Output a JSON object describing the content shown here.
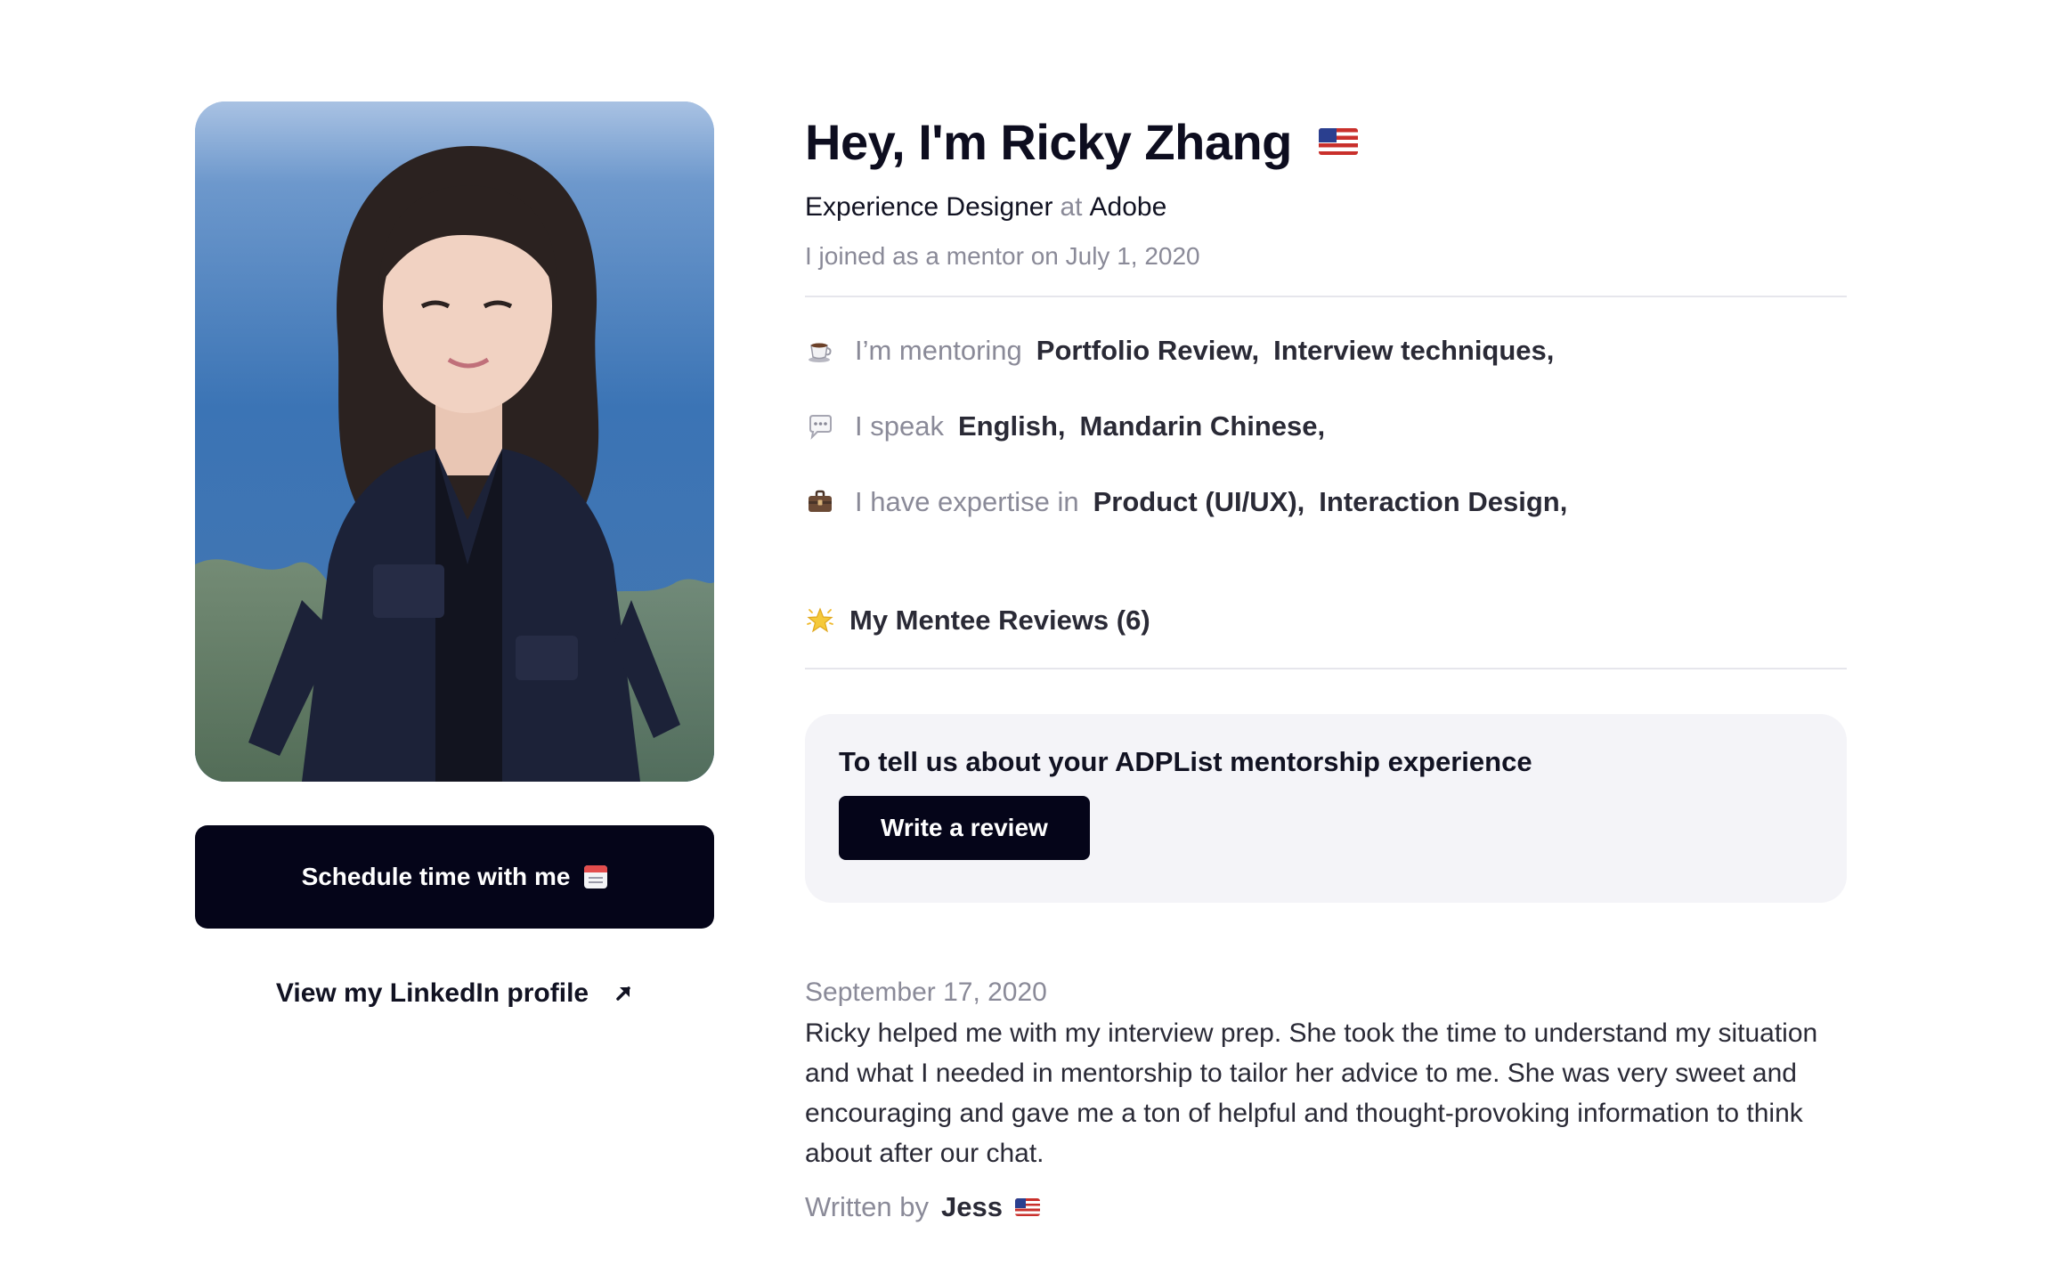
{
  "profile": {
    "name_heading": "Hey, I'm Ricky Zhang",
    "country_flag_icon": "us-flag-icon",
    "title": "Experience Designer",
    "at_text": "at",
    "company": "Adobe",
    "joined_prefix": "I joined as a mentor on",
    "joined_date": "July 1, 2020",
    "photo_alt": "Profile photo of Ricky Zhang"
  },
  "actions": {
    "schedule_label": "Schedule time with me",
    "schedule_icon": "calendar-icon",
    "linkedin_label": "View my LinkedIn profile",
    "linkedin_icon": "arrow-up-right-icon"
  },
  "info": {
    "mentoring": {
      "icon": "coffee-icon",
      "label": "I’m mentoring",
      "values": [
        "Portfolio Review,",
        "Interview techniques,"
      ]
    },
    "speak": {
      "icon": "speech-bubble-icon",
      "label": "I speak",
      "values": [
        "English,",
        "Mandarin Chinese,"
      ]
    },
    "expertise": {
      "icon": "briefcase-icon",
      "label": "I have expertise in",
      "values": [
        "Product (UI/UX),",
        "Interaction Design,"
      ]
    }
  },
  "reviews": {
    "heading_icon": "star-icon",
    "heading": "My Mentee Reviews (6)",
    "cta_text": "To tell us about your ADPList mentorship experience",
    "cta_button": "Write a review",
    "items": [
      {
        "date": "September 17, 2020",
        "body": "Ricky helped me with my interview prep. She took the time to understand my situation and what I needed in mentorship to tailor her advice to me. She was very sweet and encouraging and gave me a ton of helpful and thought-provoking information to think about after our chat.",
        "written_by_label": "Written by",
        "author": "Jess",
        "author_flag_icon": "us-flag-icon"
      }
    ]
  },
  "colors": {
    "primary_button": "#050519",
    "muted_text": "#8a8a98",
    "card_background": "#f4f4f8",
    "divider": "#e6e6ec"
  }
}
